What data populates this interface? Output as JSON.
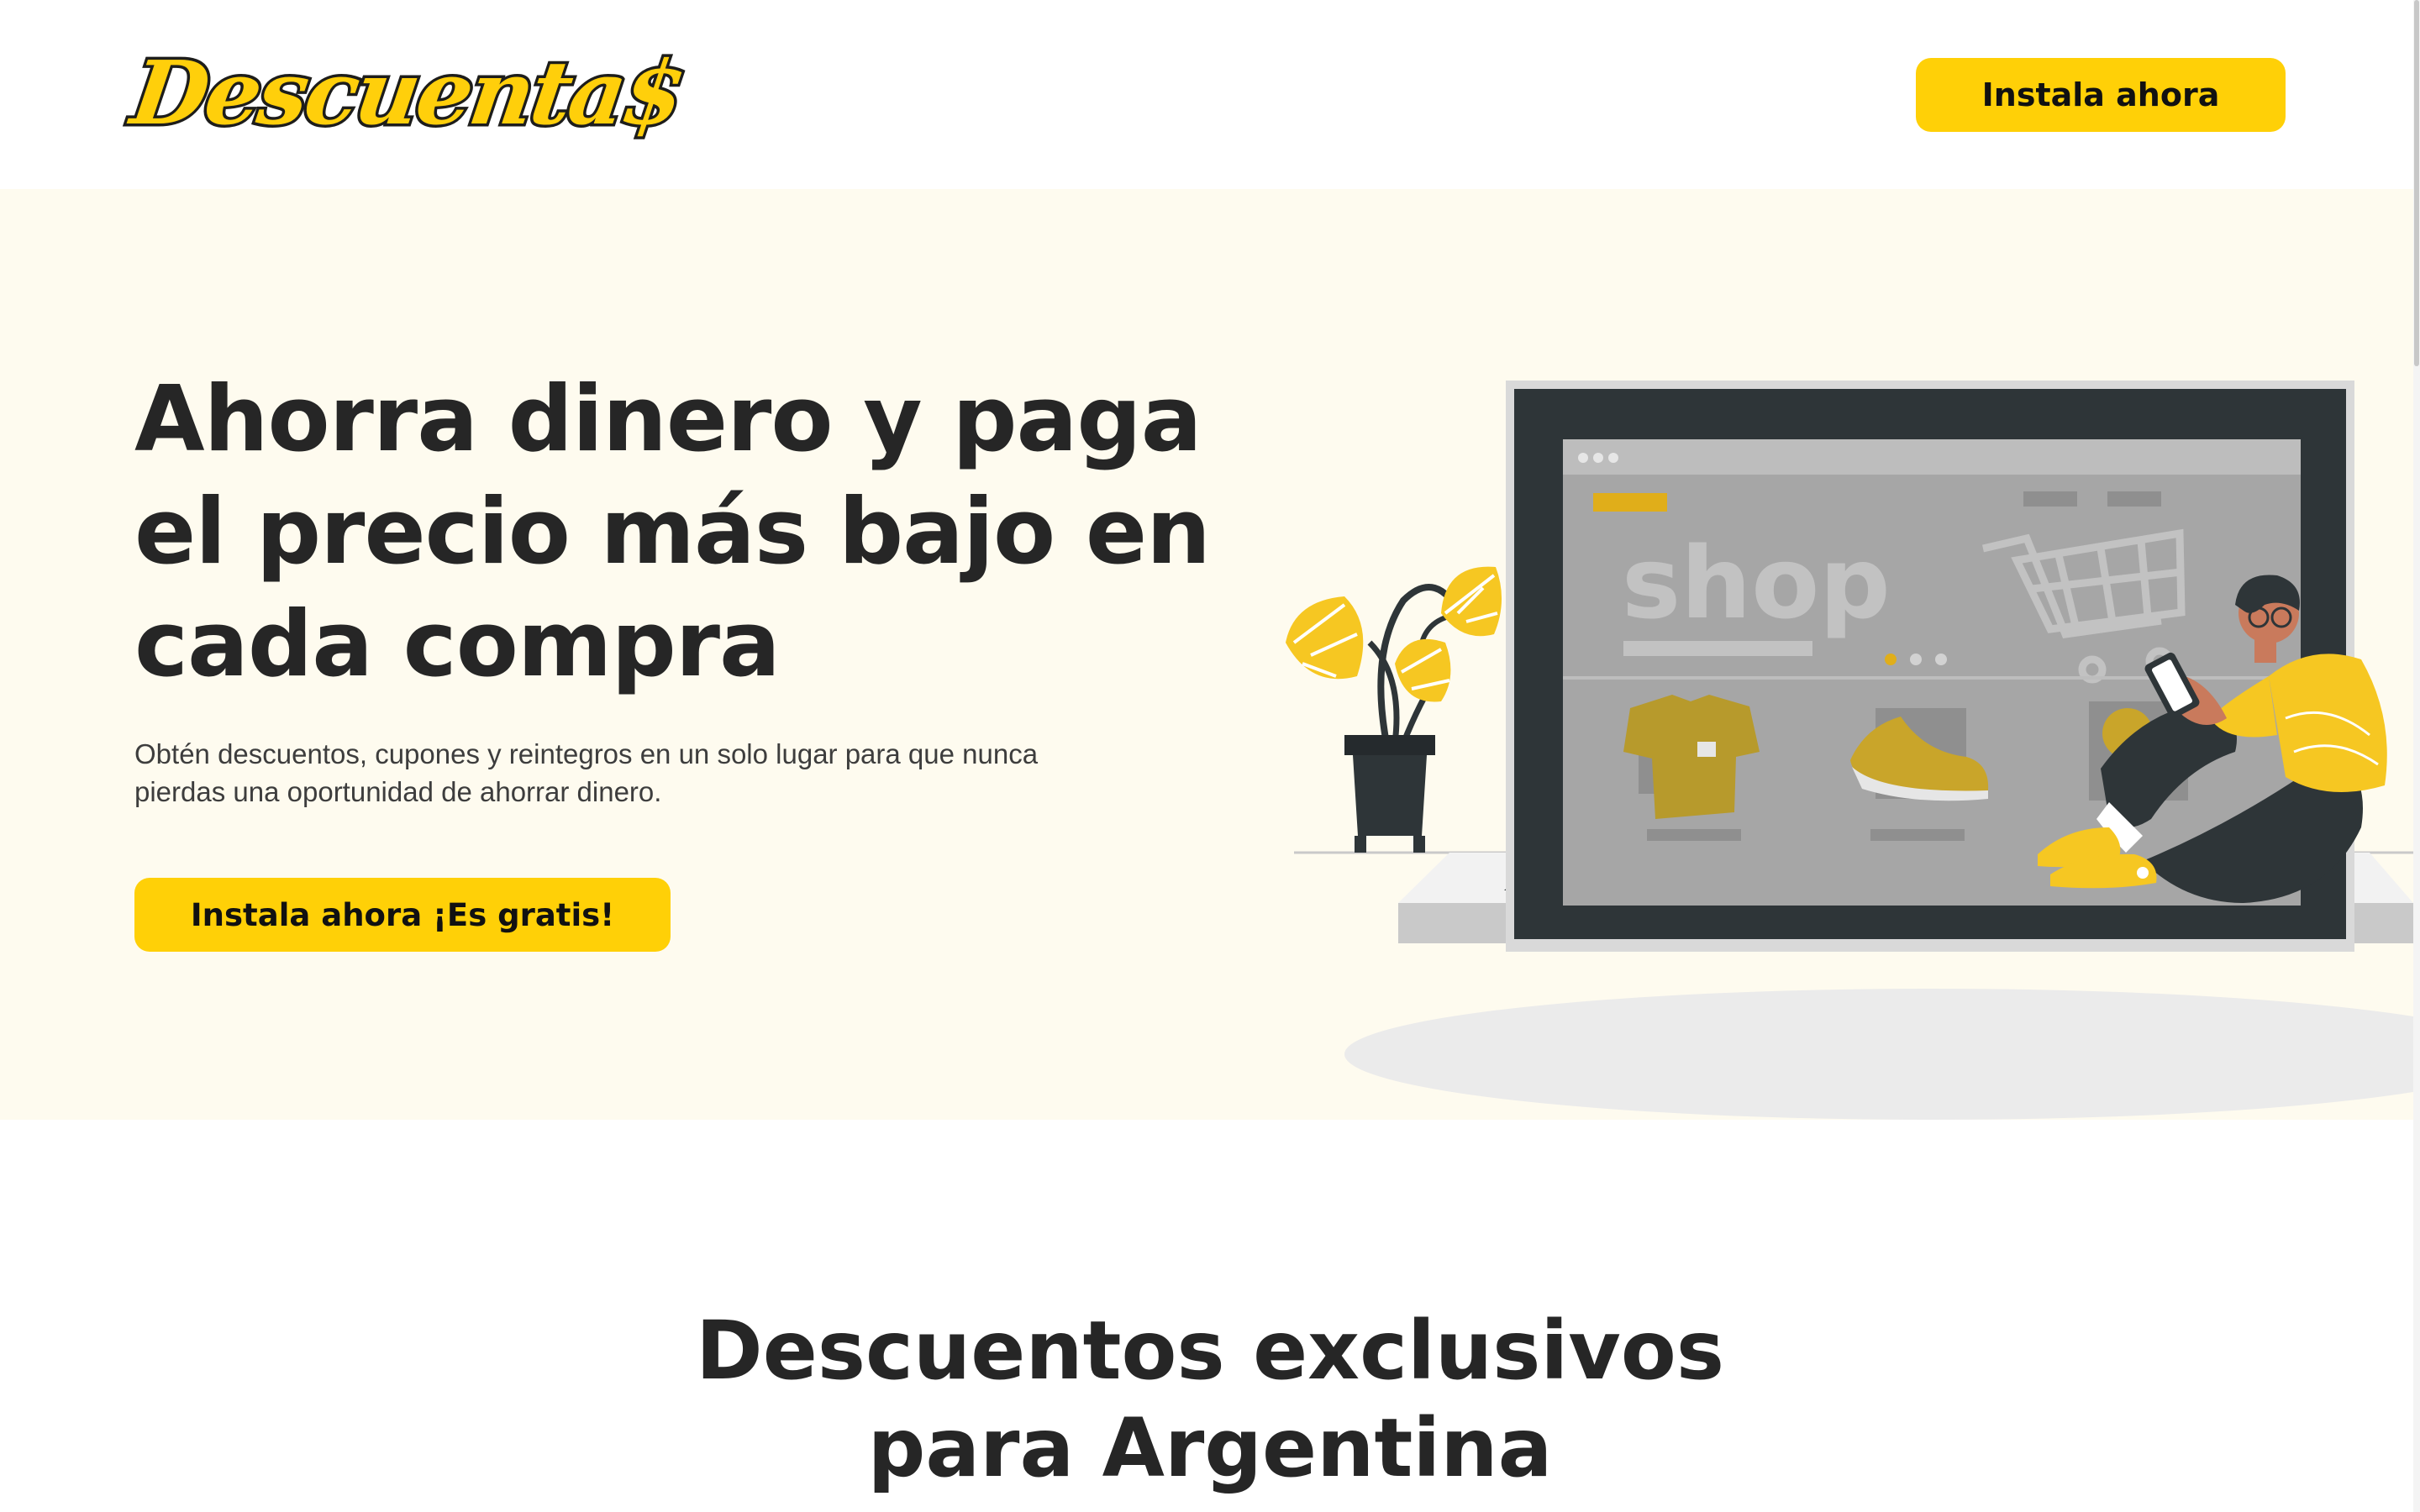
{
  "header": {
    "logo_text": "Descuenta$",
    "install_button": "Instala ahora"
  },
  "hero": {
    "title_lines": [
      "Ahorra dinero y paga",
      "el precio más bajo en",
      "cada compra"
    ],
    "subtitle_lines": [
      "Obtén descuentos, cupones y reintegros en un solo lugar para que nunca",
      "pierdas una oportunidad de ahorrar dinero."
    ],
    "cta_button": "Instala ahora ¡Es gratis!",
    "illustration": {
      "screen_text": "shop",
      "icons": [
        "laptop-icon",
        "shopping-cart-icon",
        "tshirt-icon",
        "sneaker-icon",
        "plant-icon",
        "person-with-phone-icon"
      ]
    }
  },
  "section": {
    "title_lines": [
      "Descuentos exclusivos",
      "para Argentina"
    ]
  },
  "colors": {
    "accent": "#FFD007",
    "hero_bg": "#FEFBEF",
    "text": "#262626",
    "illustration_yellow": "#F6C722",
    "illustration_dark": "#2E3538",
    "illustration_gold": "#B79A2C"
  }
}
